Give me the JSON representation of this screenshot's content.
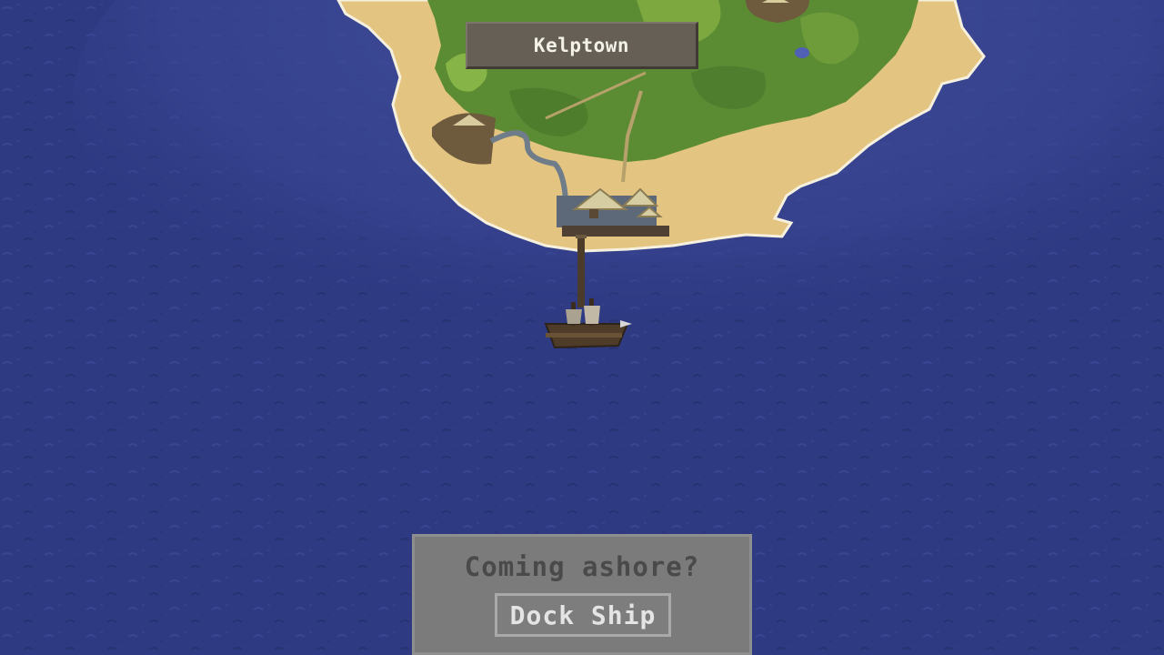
{
  "map": {
    "town_name": "Kelptown",
    "colors": {
      "deep_ocean": "#2e3a82",
      "shallow_water": "#394592",
      "sand": "#e4c481",
      "grass": "#5b8c33",
      "foliage_light": "#9bc450",
      "shoreline_foam": "#f6f1df"
    }
  },
  "dock_prompt": {
    "question": "Coming ashore?",
    "button_label": "Dock Ship"
  }
}
